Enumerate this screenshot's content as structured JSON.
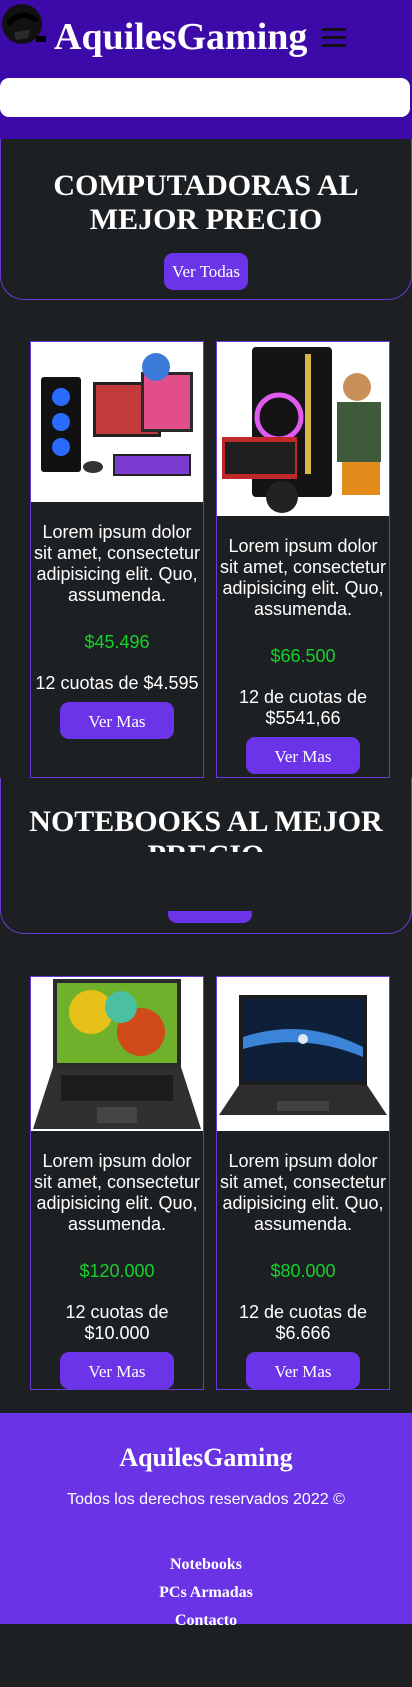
{
  "header": {
    "brand": "AquilesGaming",
    "menu_icon": "hamburger-icon",
    "search_placeholder": ""
  },
  "sections": [
    {
      "title": "COMPUTADORAS AL MEJOR PRECIO",
      "button": "Ver Todas",
      "products": [
        {
          "image": "gaming-pc-setup",
          "description": "Lorem ipsum dolor sit amet, consectetur adipisicing elit. Quo, assumenda.",
          "price": "$45.496",
          "quota": "12 cuotas de $4.595",
          "button": "Ver Mas"
        },
        {
          "image": "gaming-pc-bundle",
          "description": "Lorem ipsum dolor sit amet, consectetur adipisicing elit. Quo, assumenda.",
          "price": "$66.500",
          "quota": "12 de cuotas de $5541,66",
          "button": "Ver Mas"
        }
      ]
    },
    {
      "title": "NOTEBOOKS AL MEJOR PRECIO",
      "button": "",
      "products": [
        {
          "image": "colorful-laptop",
          "description": "Lorem ipsum dolor sit amet, consectetur adipisicing elit. Quo, assumenda.",
          "price": "$120.000",
          "quota": "12 cuotas de $10.000",
          "button": "Ver Mas"
        },
        {
          "image": "hp-laptop",
          "description": "Lorem ipsum dolor sit amet, consectetur adipisicing elit. Quo, assumenda.",
          "price": "$80.000",
          "quota": "12 de cuotas de $6.666",
          "button": "Ver Mas"
        }
      ]
    }
  ],
  "footer": {
    "brand": "AquilesGaming",
    "rights": "Todos los derechos reservados 2022 ©",
    "links": [
      "Notebooks",
      "PCs Armadas",
      "Contacto"
    ]
  },
  "colors": {
    "header": "#3c0aa8",
    "accent": "#6c34e8",
    "price": "#16d02a",
    "background": "#1d2023",
    "footer": "#6a34e6"
  }
}
